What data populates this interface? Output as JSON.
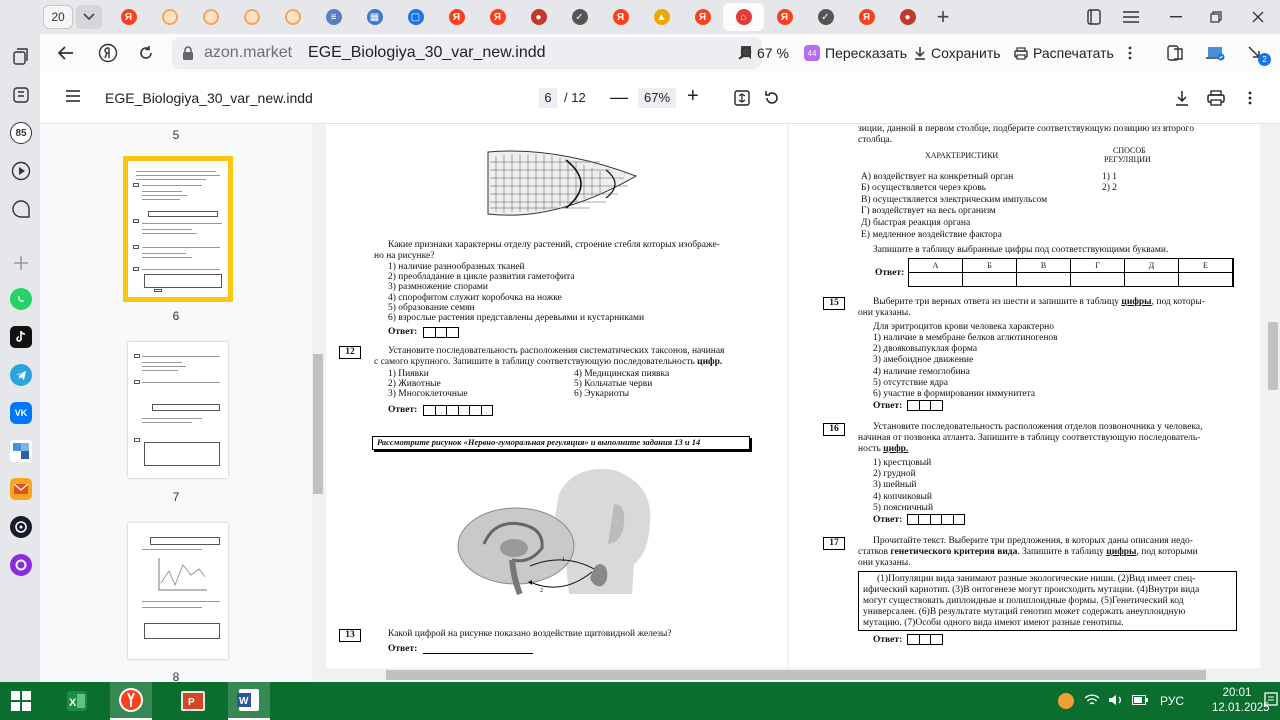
{
  "browser": {
    "tab_count": "20",
    "tab_favicons": [
      "yandex-icon",
      "circle-icon",
      "circle-icon",
      "circle-icon",
      "circle-icon",
      "doc-icon",
      "blocks-icon",
      "chat-icon",
      "yandex-icon",
      "yandex-icon",
      "person-icon",
      "check-icon",
      "yandex-icon",
      "image-icon",
      "yandex-icon",
      "cart-icon",
      "yandex-icon",
      "check-icon",
      "yandex-icon",
      "person-icon"
    ],
    "address": {
      "domain": "azon.market",
      "title": "EGE_Biologiya_30_var_new.indd"
    },
    "actions": {
      "zoom": "67 %",
      "retell": "Пересказать",
      "save": "Сохранить",
      "print": "Распечатать"
    },
    "sidebar_badges": {
      "notifications": "85"
    },
    "profile_badge": "2"
  },
  "pdf": {
    "filename": "EGE_Biologiya_30_var_new.indd",
    "current_page": "6",
    "total_pages": "/ 12",
    "zoom": "67%",
    "thumb_labels": [
      "5",
      "6",
      "7",
      "8"
    ],
    "left_page": {
      "q11_text": [
        "Какие признаки характерны отделу растений, строение стебля которых изображе-",
        "но на рисунке?"
      ],
      "q11_options": [
        "1) наличие разнообразных тканей",
        "2) преобладание в цикле развития гаметофита",
        "3) размножение спорами",
        "4) спорофитом служит коробочка на ножке",
        "5) образование семян",
        "6) взрослые растения представлены деревьями и кустарниками"
      ],
      "answer_label": "Ответ:",
      "q12_num": "12",
      "q12_text": [
        "Установите последовательность расположения систематических таксонов, начиная",
        "с самого крупного. Запишите в таблицу соответствующую последовательность"
      ],
      "q12_bold": "цифр.",
      "q12_options_left": [
        "1) Пиявки",
        "2) Животные",
        "3) Многоклеточные"
      ],
      "q12_options_right": [
        "4) Медицинская пиявка",
        "5) Кольчатые черви",
        "6) Эукариоты"
      ],
      "figure_caption": "Рассмотрите рисунок «Нервно-гуморальная регуляция» и выполните задания 13 и 14",
      "q13_num": "13",
      "q13_text": "Какой цифрой на рисунке показано воздействие щитовидной железы?",
      "figure_labels": [
        "1",
        "2"
      ]
    },
    "right_page": {
      "intro": [
        "зиции, данной в первом столбце, подберите соответствующую позицию из второго",
        "столбца."
      ],
      "col_left_header": "ХАРАКТЕРИСТИКИ",
      "col_right_header": [
        "СПОСОБ",
        "РЕГУЛЯЦИИ"
      ],
      "characteristics": [
        "А) воздействует на конкретный орган",
        "Б) осуществляется через кровь",
        "В) осуществляется электрическим импульсом",
        "Г) воздействует на весь организм",
        "Д) быстрая реакция органа",
        "Е) медленное воздействие фактора"
      ],
      "regulation": [
        "1) 1",
        "2) 2"
      ],
      "table_instruction": "Запишите в таблицу выбранные цифры под соответствующими буквами.",
      "answer_label": "Ответ:",
      "table_letters": [
        "А",
        "Б",
        "В",
        "Г",
        "Д",
        "Е"
      ],
      "q15_num": "15",
      "q15_text": [
        "Выберите три верных ответа из шести и запишите в таблицу",
        "они указаны."
      ],
      "q15_bold": "цифры",
      "q15_tail": ", под которы-",
      "q15_stem": "Для эритроцитов крови человека характерно",
      "q15_options": [
        "1) наличие в мембране белков аглютиногенов",
        "2) двояковыпуклая форма",
        "3) амебоидное движение",
        "4) наличие гемоглобина",
        "5) отсутствие ядра",
        "6) участие в формировании иммунитета"
      ],
      "q16_num": "16",
      "q16_text": [
        "Установите последовательность расположения отделов позвоночника у человека,",
        "начиная от позвонка атланта. Запишите в таблицу соответствующую последователь-",
        "ность"
      ],
      "q16_bold": "цифр.",
      "q16_options": [
        "1) крестцовый",
        "2) грудной",
        "3) шейный",
        "4) копчиковый",
        "5) поясничный"
      ],
      "q17_num": "17",
      "q17_text_a": "Прочитайте текст. Выберите три предложения, в которых даны описания недо-",
      "q17_text_b1": "статков",
      "q17_text_b_bold": "генетического критерия вида",
      "q17_text_b2": ". Запишите в таблицу",
      "q17_text_b_bold2": "цифры",
      "q17_text_b3": ", под которыми",
      "q17_text_c": "они указаны.",
      "q17_passage": [
        "(1)Популяции вида занимают разные экологические ниши. (2)Вид имеет спец-",
        "ифический кариотип. (3)В онтогенезе могут происходить мутации. (4)Внутри вида",
        "могут существовать диплоидные и полиплоидные формы. (5)Генетический код",
        "универсален. (6)В результате мутаций генотип может содержать анеуплоидную",
        "мутацию. (7)Особи одного вида имеют имеют разные генотипы."
      ]
    }
  },
  "taskbar": {
    "language": "РУС",
    "time": "20:01",
    "date": "12.01.2025"
  },
  "colors": {
    "thumb_highlight": "#f9c613",
    "taskbar": "#0b6e2e",
    "yandex_red": "#fc3f1d"
  }
}
